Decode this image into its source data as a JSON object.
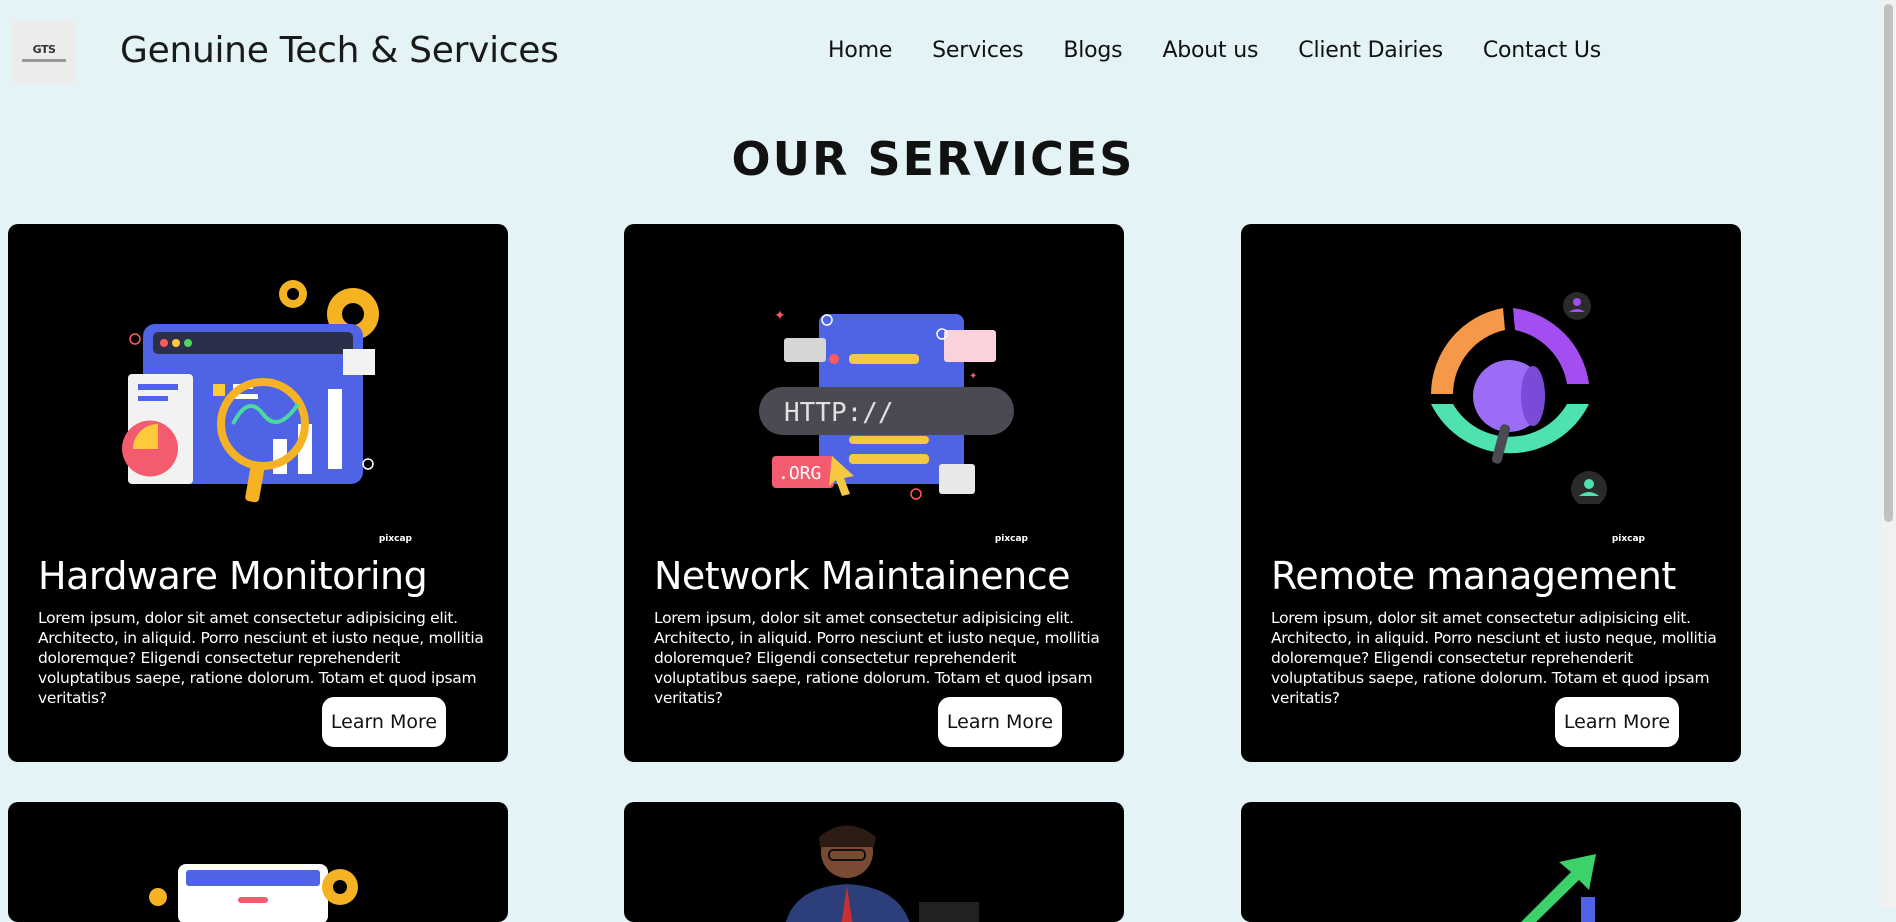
{
  "header": {
    "logo_text": "GTS",
    "brand": "Genuine Tech & Services",
    "nav": [
      "Home",
      "Services",
      "Blogs",
      "About us",
      "Client Dairies",
      "Contact Us"
    ]
  },
  "section_title": "OUR SERVICES",
  "cards": [
    {
      "title": "Hardware Monitoring",
      "description": "Lorem ipsum, dolor sit amet consectetur adipisicing elit. Architecto, in aliquid. Porro nesciunt et iusto neque, mollitia doloremque? Eligendi consectetur reprehenderit voluptatibus saepe, ratione dolorum. Totam et quod ipsam veritatis?",
      "button": "Learn More",
      "watermark": "pixcap",
      "illustration": "dashboard-magnifier-icon"
    },
    {
      "title": "Network Maintainence",
      "description": "Lorem ipsum, dolor sit amet consectetur adipisicing elit. Architecto, in aliquid. Porro nesciunt et iusto neque, mollitia doloremque? Eligendi consectetur reprehenderit voluptatibus saepe, ratione dolorum. Totam et quod ipsam veritatis?",
      "button": "Learn More",
      "watermark": "pixcap",
      "illustration": "server-http-icon",
      "illustration_text": [
        "HTTP://",
        ".ORG"
      ]
    },
    {
      "title": "Remote management",
      "description": "Lorem ipsum, dolor sit amet consectetur adipisicing elit. Architecto, in aliquid. Porro nesciunt et iusto neque, mollitia doloremque? Eligendi consectetur reprehenderit voluptatibus saepe, ratione dolorum. Totam et quod ipsam veritatis?",
      "button": "Learn More",
      "watermark": "pixcap",
      "illustration": "megaphone-donut-icon"
    }
  ],
  "colors": {
    "background": "#e4f3f6",
    "card": "#000000",
    "button": "#ffffff"
  }
}
